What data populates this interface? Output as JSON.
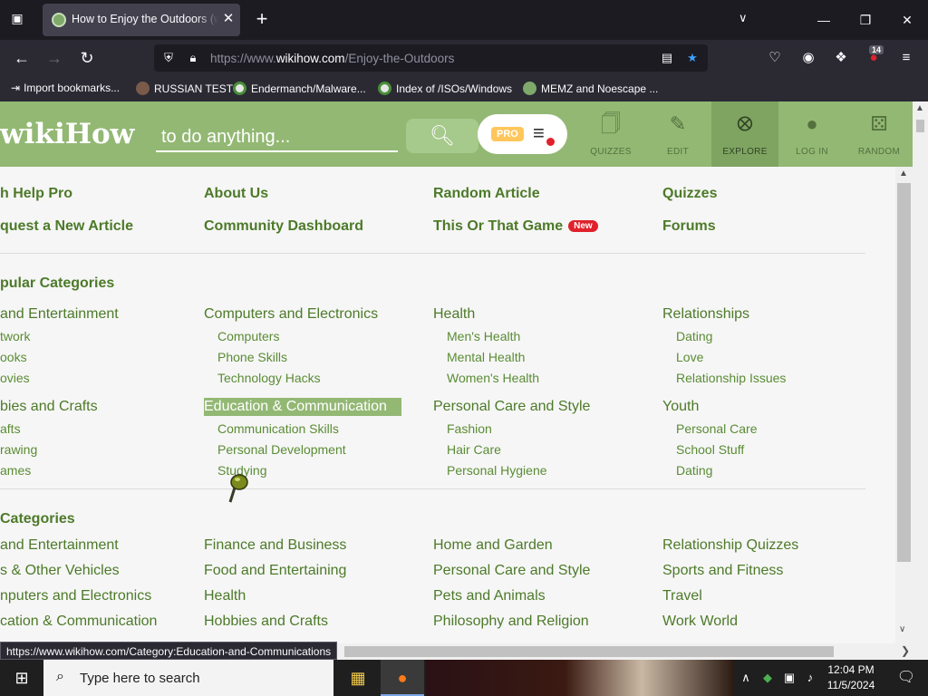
{
  "browser": {
    "tab_title": "How to Enjoy the Outdoors (with",
    "url_prefix": "https://www.",
    "url_host": "wikihow.com",
    "url_path": "/Enjoy-the-Outdoors",
    "extension_badge": "14",
    "bookmarks": [
      "Import bookmarks...",
      "RUSSIAN TEST",
      "Endermanch/Malware...",
      "Index of /ISOs/Windows",
      "MEMZ and Noescape ..."
    ],
    "status_url": "https://www.wikihow.com/Category:Education-and-Communications"
  },
  "wikihow": {
    "logo_wiki": "wiki",
    "logo_how": "How",
    "search_placeholder": "to do anything...",
    "pro_badge": "PRO",
    "nav": [
      "QUIZZES",
      "EDIT",
      "EXPLORE",
      "LOG IN",
      "RANDOM"
    ],
    "top_links": {
      "col1": [
        "h Help Pro",
        "quest a New Article"
      ],
      "col2": [
        "About Us",
        "Community Dashboard"
      ],
      "col3": [
        "Random Article",
        "This Or That Game"
      ],
      "col4": [
        "Quizzes",
        "Forums"
      ],
      "new_badge": "New"
    },
    "popular_title": "pular Categories",
    "popular": {
      "col1": {
        "h1": "and Entertainment",
        "s1": [
          "twork",
          "ooks",
          "ovies"
        ],
        "h2": "bies and Crafts",
        "s2": [
          "afts",
          "rawing",
          "ames"
        ]
      },
      "col2": {
        "h1": "Computers and Electronics",
        "s1": [
          "Computers",
          "Phone Skills",
          "Technology Hacks"
        ],
        "h2": "Education & Communication",
        "s2": [
          "Communication Skills",
          "Personal Development",
          "Studying"
        ]
      },
      "col3": {
        "h1": "Health",
        "s1": [
          "Men's Health",
          "Mental Health",
          "Women's Health"
        ],
        "h2": "Personal Care and Style",
        "s2": [
          "Fashion",
          "Hair Care",
          "Personal Hygiene"
        ]
      },
      "col4": {
        "h1": "Relationships",
        "s1": [
          "Dating",
          "Love",
          "Relationship Issues"
        ],
        "h2": "Youth",
        "s2": [
          "Personal Care",
          "School Stuff",
          "Dating"
        ]
      }
    },
    "all_title": "Categories",
    "all": {
      "col1": [
        "and Entertainment",
        "s & Other Vehicles",
        "nputers and Electronics",
        "cation & Communication"
      ],
      "col2": [
        "Finance and Business",
        "Food and Entertaining",
        "Health",
        "Hobbies and Crafts"
      ],
      "col3": [
        "Home and Garden",
        "Personal Care and Style",
        "Pets and Animals",
        "Philosophy and Religion"
      ],
      "col4": [
        "Relationship Quizzes",
        "Sports and Fitness",
        "Travel",
        "Work World"
      ]
    }
  },
  "taskbar": {
    "search_placeholder": "Type here to search",
    "time": "12:04 PM",
    "date": "11/5/2024"
  },
  "colors": {
    "header_green": "#93b874",
    "link_green": "#4d7a29",
    "new_red": "#e0212b"
  }
}
